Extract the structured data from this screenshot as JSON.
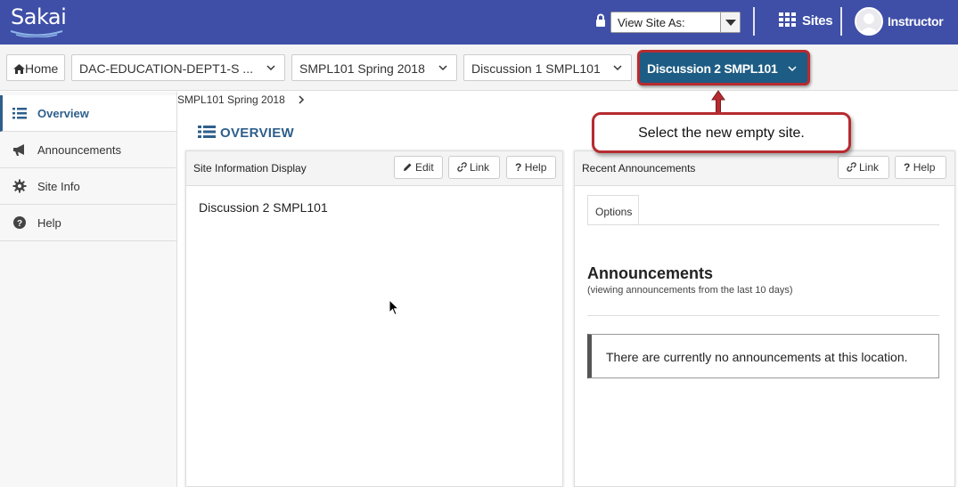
{
  "header": {
    "logo_text": "Sakai",
    "view_site_as_label": "View Site As:",
    "sites_label": "Sites",
    "user_name": "Instructor",
    "brand_color": "#3f4fa7"
  },
  "sitenav": {
    "home_label": "Home",
    "sites": [
      {
        "label": "DAC-EDUCATION-DEPT1-S ..."
      },
      {
        "label": "SMPL101 Spring 2018"
      },
      {
        "label": "Discussion 1 SMPL101"
      },
      {
        "label": "Discussion 2 SMPL101",
        "current": true
      }
    ]
  },
  "toolmenu": {
    "items": [
      {
        "label": "Overview",
        "icon": "list-icon",
        "active": true
      },
      {
        "label": "Announcements",
        "icon": "megaphone-icon"
      },
      {
        "label": "Site Info",
        "icon": "gear-icon"
      },
      {
        "label": "Help",
        "icon": "question-circle-icon"
      }
    ]
  },
  "main": {
    "breadcrumb": "SMPL101 Spring 2018",
    "page_title": "OVERVIEW",
    "site_info": {
      "title": "Site Information Display",
      "edit_label": "Edit",
      "link_label": "Link",
      "help_label": "Help",
      "description": "Discussion 2 SMPL101"
    },
    "recent_announcements": {
      "title": "Recent Announcements",
      "link_label": "Link",
      "help_label": "Help",
      "options_tab": "Options",
      "heading": "Announcements",
      "subheading": "(viewing announcements from the last 10 days)",
      "empty_message": "There are currently no announcements at this location."
    }
  },
  "callout": {
    "text": "Select the new empty site.",
    "accent_color": "#b62b30"
  }
}
